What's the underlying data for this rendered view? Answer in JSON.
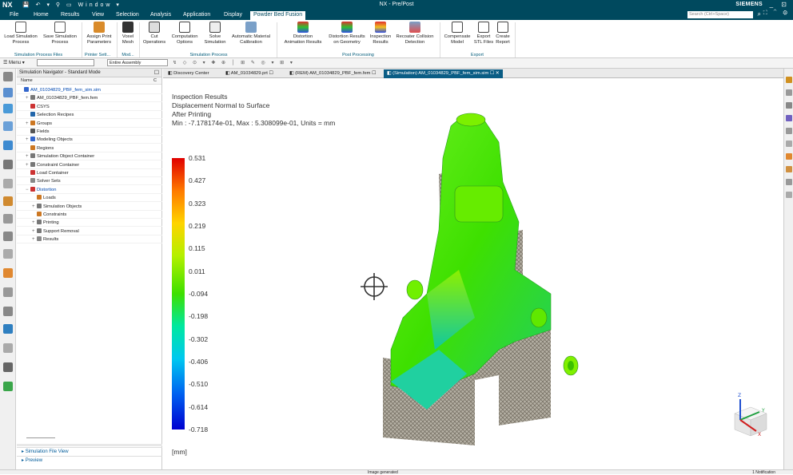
{
  "titlebar": {
    "logo": "NX",
    "window_menu": "Window",
    "title": "NX - Pre/Post",
    "brand": "SIEMENS",
    "window_controls": "_ ⊡"
  },
  "menu": {
    "tabs": [
      "File",
      "Home",
      "Results",
      "View",
      "Selection",
      "Analysis",
      "Application",
      "Display",
      "Powder Bed Fusion"
    ],
    "active_tab": "Powder Bed Fusion",
    "search_placeholder": "Search (Ctrl+Space)"
  },
  "ribbon": {
    "buttons": [
      {
        "label": "Load Simulation\nProcess",
        "icon": "load-simulation-icon"
      },
      {
        "label": "Save Simulation\nProcess",
        "icon": "save-simulation-icon"
      },
      {
        "label": "Assign Print\nParameters",
        "icon": "assign-print-icon"
      },
      {
        "label": "Voxel\nMesh",
        "icon": "voxel-mesh-icon"
      },
      {
        "label": "Cut\nOperations",
        "icon": "cut-operations-icon"
      },
      {
        "label": "Computation\nOptions",
        "icon": "computation-options-icon"
      },
      {
        "label": "Solve\nSimulation",
        "icon": "solve-icon"
      },
      {
        "label": "Automatic Material\nCalibration",
        "icon": "calibration-icon"
      },
      {
        "label": "Distortion\nAnimation Results",
        "icon": "distortion-anim-icon"
      },
      {
        "label": "Distortion Results\non Geometry",
        "icon": "distortion-geom-icon"
      },
      {
        "label": "Inspection\nResults",
        "icon": "inspection-icon"
      },
      {
        "label": "Recoater Collision\nDetection",
        "icon": "recoater-icon"
      },
      {
        "label": "Compensate\nModel",
        "icon": "compensate-icon"
      },
      {
        "label": "Export\nSTL Files",
        "icon": "export-stl-icon"
      },
      {
        "label": "Create\nReport",
        "icon": "report-icon"
      }
    ],
    "groups": [
      "Simulation Process Files",
      "Printer Sett...",
      "Mod...",
      "Simulation Process",
      "Post Processing",
      "Export"
    ]
  },
  "toolbar": {
    "menu_label": "Menu",
    "filter_value": "",
    "assembly_value": "Entire Assembly"
  },
  "navigator": {
    "title": "Simulation Navigator - Standard Mode",
    "col_name": "Name",
    "col_c": "C",
    "items": [
      {
        "label": "AM_01034829_PBF_fem_sim.sim",
        "indent": 0,
        "twisty": "",
        "color": "#3366cc",
        "sel": true
      },
      {
        "label": "AM_01034829_PBF_fem.fem",
        "indent": 1,
        "twisty": "+",
        "color": "#777777",
        "sel": false
      },
      {
        "label": "CSYS",
        "indent": 1,
        "twisty": "",
        "color": "#cc3333",
        "sel": false
      },
      {
        "label": "Selection Recipes",
        "indent": 1,
        "twisty": "",
        "color": "#2266aa",
        "sel": false
      },
      {
        "label": "Groups",
        "indent": 1,
        "twisty": "+",
        "color": "#cc7722",
        "sel": false
      },
      {
        "label": "Fields",
        "indent": 1,
        "twisty": "",
        "color": "#555555",
        "sel": false
      },
      {
        "label": "Modeling Objects",
        "indent": 1,
        "twisty": "+",
        "color": "#3366cc",
        "sel": false
      },
      {
        "label": "Regions",
        "indent": 1,
        "twisty": "",
        "color": "#cc7722",
        "sel": false
      },
      {
        "label": "Simulation Object Container",
        "indent": 1,
        "twisty": "+",
        "color": "#777777",
        "sel": false
      },
      {
        "label": "Constraint Container",
        "indent": 1,
        "twisty": "+",
        "color": "#777777",
        "sel": false
      },
      {
        "label": "Load Container",
        "indent": 1,
        "twisty": "",
        "color": "#cc3333",
        "sel": false
      },
      {
        "label": "Solver Sets",
        "indent": 1,
        "twisty": "",
        "color": "#888888",
        "sel": false
      },
      {
        "label": "Distortion",
        "indent": 1,
        "twisty": "−",
        "color": "#cc3333",
        "sel": true
      },
      {
        "label": "Loads",
        "indent": 2,
        "twisty": "",
        "color": "#cc7722",
        "sel": false
      },
      {
        "label": "Simulation Objects",
        "indent": 2,
        "twisty": "+",
        "color": "#777777",
        "sel": false
      },
      {
        "label": "Constraints",
        "indent": 2,
        "twisty": "",
        "color": "#cc7722",
        "sel": false
      },
      {
        "label": "Printing",
        "indent": 2,
        "twisty": "+",
        "color": "#777777",
        "sel": false
      },
      {
        "label": "Support Removal",
        "indent": 2,
        "twisty": "+",
        "color": "#777777",
        "sel": false
      },
      {
        "label": "Results",
        "indent": 2,
        "twisty": "+",
        "color": "#888888",
        "sel": false
      }
    ],
    "bottom_panels": [
      "Simulation File View",
      "Preview"
    ]
  },
  "doc_tabs": [
    {
      "label": "Discovery Center",
      "active": false
    },
    {
      "label": "AM_01034829.prt",
      "active": false
    },
    {
      "label": "(REM) AM_01034829_PBF_fem.fem",
      "active": false
    },
    {
      "label": "(Simulation) AM_01034829_PBF_fem_sim.sim",
      "active": true
    }
  ],
  "viewport": {
    "lines": [
      "Inspection Results",
      "Displacement Normal to Surface",
      "After Printing",
      "Min : -7.178174e-01, Max : 5.308099e-01, Units = mm"
    ],
    "legend_values": [
      "0.531",
      "0.427",
      "0.323",
      "0.219",
      "0.115",
      "0.011",
      "-0.094",
      "-0.198",
      "-0.302",
      "-0.406",
      "-0.510",
      "-0.614",
      "-0.718"
    ],
    "units_label": "[mm]",
    "triad_labels": {
      "z": "Z",
      "y": "Y",
      "x": "X"
    }
  },
  "status": {
    "message": "Image generated",
    "notification": "1 Notification"
  }
}
